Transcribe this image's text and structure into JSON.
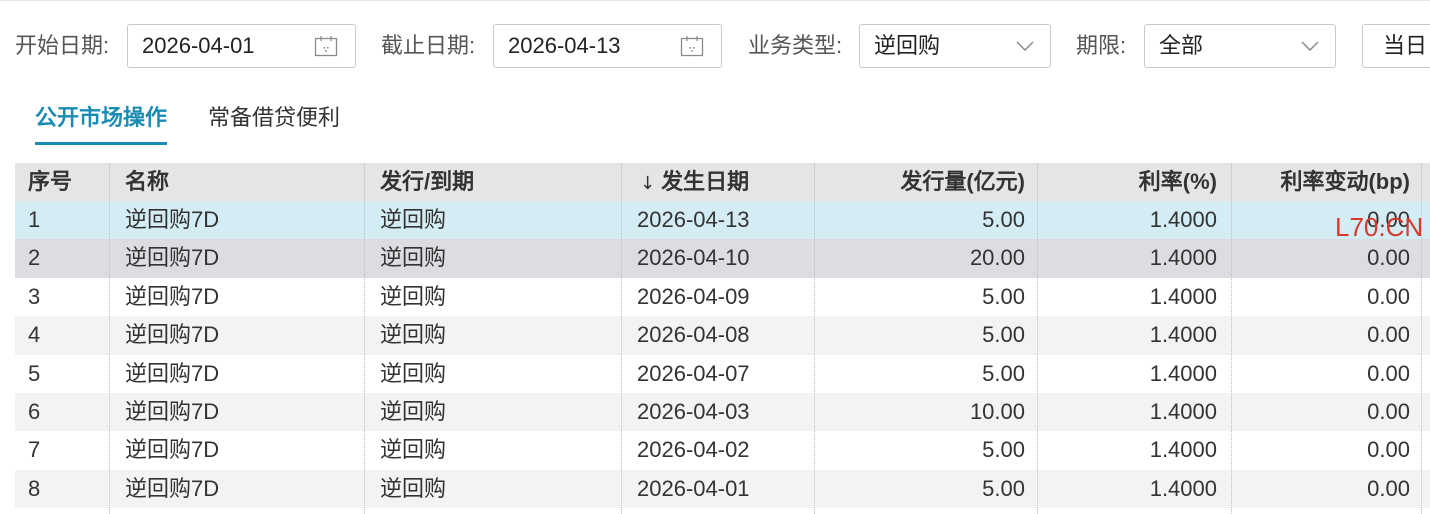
{
  "colors": {
    "accent": "#1a8cb4",
    "header_bg": "#e5e5e5",
    "row_selected_bg": "#d4edf5",
    "row_hover_bg": "#dcdde0",
    "row_alt_bg": "#f2f3f3",
    "watermark": "#d63a2a"
  },
  "filters": {
    "start_date": {
      "label": "开始日期:",
      "value": "2026-04-01",
      "icon": "calendar-icon"
    },
    "end_date": {
      "label": "截止日期:",
      "value": "2026-04-13",
      "icon": "calendar-icon"
    },
    "business_type": {
      "label": "业务类型:",
      "value": "逆回购",
      "icon": "chevron-down-icon"
    },
    "term": {
      "label": "期限:",
      "value": "全部",
      "icon": "chevron-down-icon"
    },
    "today_button": {
      "label": "当日"
    }
  },
  "tabs": [
    {
      "label": "公开市场操作",
      "active": true
    },
    {
      "label": "常备借贷便利",
      "active": false
    }
  ],
  "table": {
    "columns": {
      "index": "序号",
      "name": "名称",
      "type": "发行/到期",
      "date": "发生日期",
      "amount": "发行量(亿元)",
      "rate": "利率(%)",
      "rate_change": "利率变动(bp)"
    },
    "sort_glyph": "↓",
    "sort_icon": "arrow-down-icon",
    "rows": [
      {
        "index": "1",
        "name": "逆回购7D",
        "type": "逆回购",
        "date": "2026-04-13",
        "amount": "5.00",
        "rate": "1.4000",
        "rate_change": "0.00"
      },
      {
        "index": "2",
        "name": "逆回购7D",
        "type": "逆回购",
        "date": "2026-04-10",
        "amount": "20.00",
        "rate": "1.4000",
        "rate_change": "0.00"
      },
      {
        "index": "3",
        "name": "逆回购7D",
        "type": "逆回购",
        "date": "2026-04-09",
        "amount": "5.00",
        "rate": "1.4000",
        "rate_change": "0.00"
      },
      {
        "index": "4",
        "name": "逆回购7D",
        "type": "逆回购",
        "date": "2026-04-08",
        "amount": "5.00",
        "rate": "1.4000",
        "rate_change": "0.00"
      },
      {
        "index": "5",
        "name": "逆回购7D",
        "type": "逆回购",
        "date": "2026-04-07",
        "amount": "5.00",
        "rate": "1.4000",
        "rate_change": "0.00"
      },
      {
        "index": "6",
        "name": "逆回购7D",
        "type": "逆回购",
        "date": "2026-04-03",
        "amount": "10.00",
        "rate": "1.4000",
        "rate_change": "0.00"
      },
      {
        "index": "7",
        "name": "逆回购7D",
        "type": "逆回购",
        "date": "2026-04-02",
        "amount": "5.00",
        "rate": "1.4000",
        "rate_change": "0.00"
      },
      {
        "index": "8",
        "name": "逆回购7D",
        "type": "逆回购",
        "date": "2026-04-01",
        "amount": "5.00",
        "rate": "1.4000",
        "rate_change": "0.00"
      }
    ]
  },
  "watermark": "L70.CN"
}
